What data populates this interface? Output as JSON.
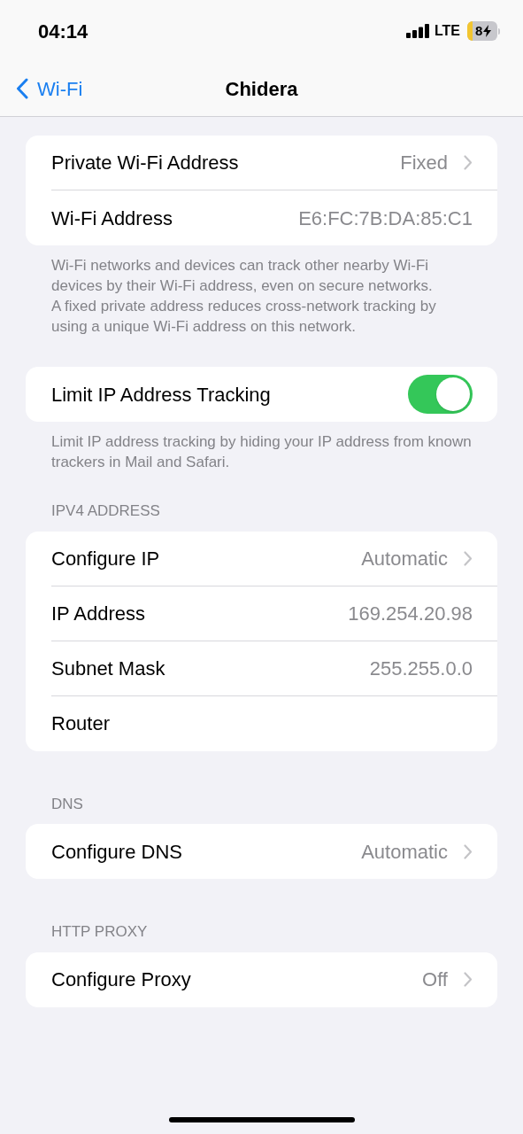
{
  "status_bar": {
    "time": "04:14",
    "network": "LTE",
    "battery": "8"
  },
  "nav": {
    "back": "Wi-Fi",
    "title": "Chidera"
  },
  "sections": [
    {
      "rows": [
        {
          "kind": "chevron",
          "label": "Private Wi-Fi Address",
          "value": "Fixed"
        },
        {
          "kind": "value",
          "label": "Wi-Fi Address",
          "value": "E6:FC:7B:DA:85:C1"
        }
      ],
      "footer": [
        "Wi-Fi networks and devices can track other nearby Wi-Fi devices by their Wi-Fi address, even on secure networks.",
        "A fixed private address reduces cross-network tracking by using a unique Wi-Fi address on this network."
      ]
    },
    {
      "rows": [
        {
          "kind": "toggle",
          "label": "Limit IP Address Tracking",
          "on": true
        }
      ],
      "footer": [
        "Limit IP address tracking by hiding your IP address from known trackers in Mail and Safari."
      ]
    },
    {
      "header": "IPV4 ADDRESS",
      "rows": [
        {
          "kind": "chevron",
          "label": "Configure IP",
          "value": "Automatic"
        },
        {
          "kind": "value",
          "label": "IP Address",
          "value": "169.254.20.98"
        },
        {
          "kind": "value",
          "label": "Subnet Mask",
          "value": "255.255.0.0"
        },
        {
          "kind": "value",
          "label": "Router"
        }
      ]
    },
    {
      "header": "DNS",
      "rows": [
        {
          "kind": "chevron",
          "label": "Configure DNS",
          "value": "Automatic"
        }
      ]
    },
    {
      "header": "HTTP PROXY",
      "rows": [
        {
          "kind": "chevron",
          "label": "Configure Proxy",
          "value": "Off"
        }
      ]
    }
  ]
}
